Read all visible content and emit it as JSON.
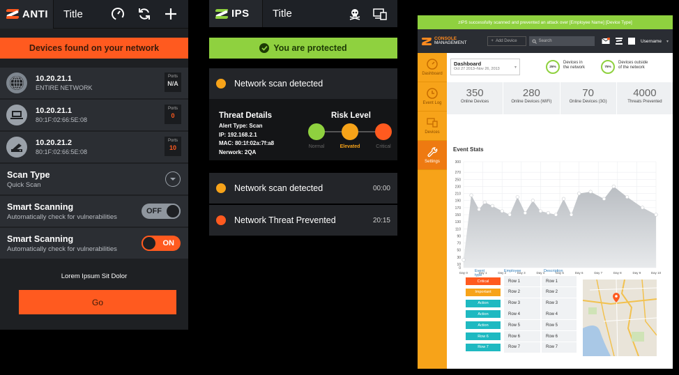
{
  "anti": {
    "brand": "ANTI",
    "title": "Title",
    "icons": [
      "speedometer-icon",
      "refresh-icon",
      "plus-icon"
    ],
    "banner": "Devices found on your network",
    "devices": [
      {
        "ip": "10.20.21.1",
        "sub": "ENTIRE NETWORK",
        "ports_label": "Ports",
        "ports": "N/A",
        "icon": "globe-icon"
      },
      {
        "ip": "10.20.21.1",
        "sub": "80:1F:02:66:5E:08",
        "ports_label": "Ports",
        "ports": "0",
        "icon": "laptop-icon"
      },
      {
        "ip": "10.20.21.2",
        "sub": "80:1F:02:66:5E:08",
        "ports_label": "Ports",
        "ports": "10",
        "icon": "router-icon"
      }
    ],
    "scan_type": {
      "title": "Scan Type",
      "sub": "Quick Scan"
    },
    "smart1": {
      "title": "Smart Scanning",
      "sub": "Automatically check for vulnerabilities",
      "state": "OFF"
    },
    "smart2": {
      "title": "Smart Scanning",
      "sub": "Automatically check for vulnerabilities",
      "state": "ON"
    },
    "footer_text": "Lorem Ipsum Sit Dolor",
    "go": "Go"
  },
  "ips": {
    "brand": "IPS",
    "title": "Title",
    "icons": [
      "skull-icon",
      "devices-icon"
    ],
    "banner": "You are protected",
    "events": [
      {
        "label": "Network scan detected",
        "time": "",
        "color": "#f7a319"
      },
      {
        "label": "Network scan detected",
        "time": "00:00",
        "color": "#f7a319"
      },
      {
        "label": "Network Threat Prevented",
        "time": "20:15",
        "color": "#ff5a1f"
      }
    ],
    "threat": {
      "title": "Threat Details",
      "lines": [
        "Alert Type: Scan",
        "IP: 192.168.2.1",
        "MAC: 80:1f:02a:7f:a8",
        "Nerwork: 2QA"
      ],
      "risk_title": "Risk Level",
      "levels": [
        {
          "label": "Normal",
          "color": "#8fd13f"
        },
        {
          "label": "Elevated",
          "color": "#f7a319"
        },
        {
          "label": "Critical",
          "color": "#ff5a1f"
        }
      ],
      "selected_level": "Elevated"
    }
  },
  "console": {
    "notification": "zIPS successfully scanned and prevented an attack over [Employee Name] [Device Type]",
    "brand_line1": "CONSOLE",
    "brand_line2": "MANAGEMENT",
    "add_device": "Add Device",
    "search_placeholder": "Search",
    "username": "Username",
    "nav": [
      {
        "label": "Dashboard",
        "icon": "speedometer-icon",
        "active": false
      },
      {
        "label": "Event Log",
        "icon": "clock-icon",
        "active": false
      },
      {
        "label": "Devices",
        "icon": "devices-icon",
        "active": false
      },
      {
        "label": "Settings",
        "icon": "wrench-icon",
        "active": true
      }
    ],
    "dashboard": {
      "title": "Dashboard",
      "range": "Oct 27 2013–Nov 26, 2013"
    },
    "rings": [
      {
        "pct": "25%",
        "label1": "Devices in",
        "label2": "the network",
        "color": "#8fd13f"
      },
      {
        "pct": "75%",
        "label1": "Devices outside",
        "label2": "of the network",
        "color": "#8fd13f"
      }
    ],
    "stats": [
      {
        "value": "350",
        "label": "Online Devices"
      },
      {
        "value": "280",
        "label": "Online Devices (WiFi)"
      },
      {
        "value": "70",
        "label": "Online Devices (3G)"
      },
      {
        "value": "4000",
        "label": "Threats Prevented"
      }
    ],
    "event_stats_title": "Event Stats",
    "table": {
      "headers": [
        "Event type",
        "Employee",
        "Description"
      ],
      "rows": [
        {
          "type": "Critical",
          "color": "#ff5a1f",
          "employee": "Row 1",
          "desc": "Row 1"
        },
        {
          "type": "Important",
          "color": "#f7a319",
          "employee": "Row 2",
          "desc": "Row 2"
        },
        {
          "type": "Action",
          "color": "#1fb9c1",
          "employee": "Row 3",
          "desc": "Row 3"
        },
        {
          "type": "Action",
          "color": "#1fb9c1",
          "employee": "Row 4",
          "desc": "Row 4"
        },
        {
          "type": "Action",
          "color": "#1fb9c1",
          "employee": "Row 5",
          "desc": "Row 5"
        },
        {
          "type": "Row 6",
          "color": "#1fb9c1",
          "employee": "Row 6",
          "desc": "Row 6"
        },
        {
          "type": "Row 7",
          "color": "#1fb9c1",
          "employee": "Row 7",
          "desc": "Row 7"
        }
      ]
    }
  },
  "chart_data": {
    "type": "area",
    "title": "Event Stats",
    "x": [
      "Day 0",
      "Day 1",
      "Day 2",
      "Day 3",
      "Day 4",
      "Day 5",
      "Day 6",
      "Day 7",
      "Day 8",
      "Day 9",
      "Day 10"
    ],
    "series": [
      {
        "values": [
          22,
          205,
          165,
          185,
          175,
          160,
          150,
          200,
          155,
          190,
          160,
          155,
          150,
          195,
          150,
          210,
          215,
          195,
          230,
          200,
          170,
          150
        ]
      }
    ],
    "series_x": [
      0,
      0.4,
      0.8,
      1.1,
      1.5,
      2.0,
      2.4,
      2.8,
      3.2,
      3.6,
      4.0,
      4.4,
      4.8,
      5.2,
      5.6,
      6.0,
      6.6,
      7.3,
      7.8,
      8.5,
      9.3,
      10.0
    ],
    "ylim": [
      0,
      300
    ],
    "yticks": [
      0,
      10,
      30,
      50,
      70,
      90,
      110,
      130,
      150,
      170,
      190,
      210,
      230,
      250,
      270,
      300
    ],
    "grid": true,
    "fill_color": "#c8cbcf",
    "point_color": "#ffffff"
  }
}
